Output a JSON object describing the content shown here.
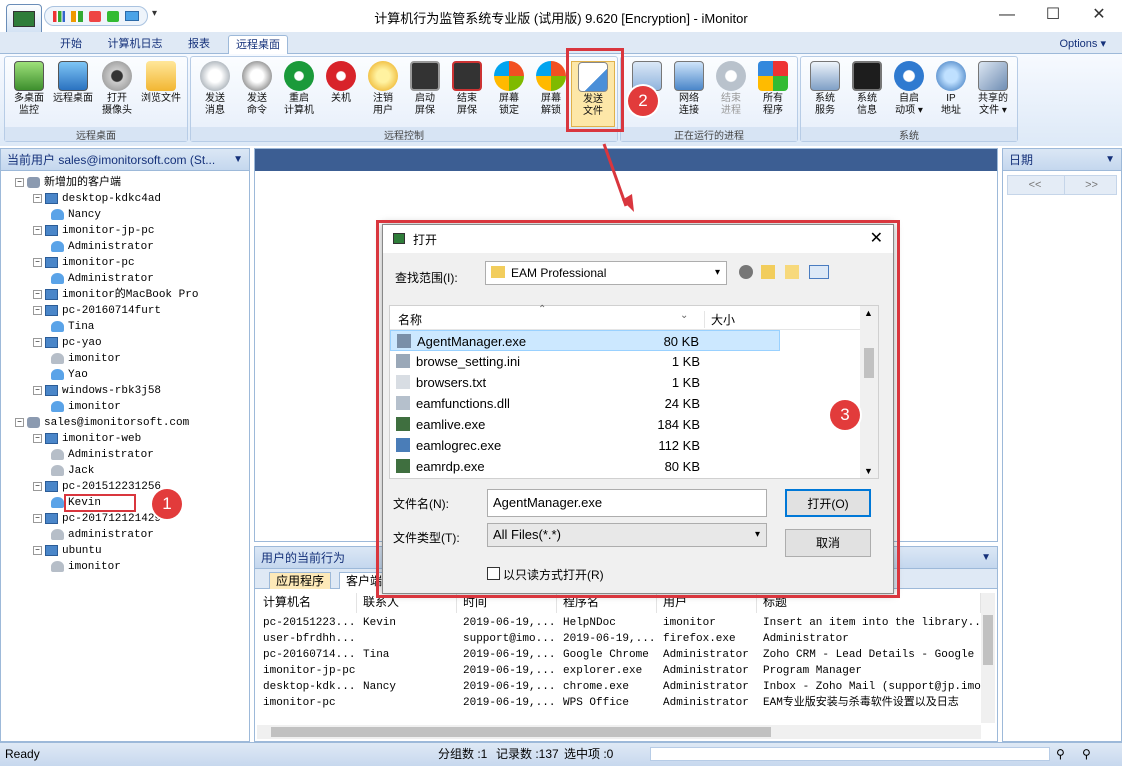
{
  "window": {
    "title": "计算机行为监管系统专业版 (试用版) 9.620 [Encryption] - iMonitor",
    "min": "—",
    "max": "☐",
    "close": "✕"
  },
  "tabs": [
    "开始",
    "计算机日志",
    "报表",
    "远程桌面"
  ],
  "options_label": "Options ▾",
  "ribbon": {
    "g1": {
      "label": "远程桌面",
      "buttons": [
        "多桌面\n监控",
        "远程桌面",
        "打开\n摄像头",
        "浏览文件"
      ]
    },
    "g2": {
      "label": "远程控制",
      "buttons": [
        "发送\n消息",
        "发送\n命令",
        "重启\n计算机",
        "关机",
        "注销\n用户",
        "启动\n屏保",
        "结束\n屏保",
        "屏幕\n锁定",
        "屏幕\n解锁",
        "发送\n文件"
      ]
    },
    "g3": {
      "label": "正在运行的进程",
      "buttons": [
        "进程",
        "网络\n连接",
        "结束\n进程",
        "所有\n程序"
      ]
    },
    "g4": {
      "label": "系统",
      "buttons": [
        "系统\n服务",
        "系统\n信息",
        "自启\n动项 ▾",
        "IP\n地址",
        "共享的\n文件 ▾"
      ]
    }
  },
  "left_pane": {
    "header": "当前用户 sales@imonitorsoft.com (St...",
    "tree": [
      {
        "t": "新增加的客户端",
        "lvl": 0,
        "k": "grp"
      },
      {
        "t": "desktop-kdkc4ad",
        "lvl": 1,
        "k": "comp"
      },
      {
        "t": "Nancy",
        "lvl": 2,
        "k": "user"
      },
      {
        "t": "imonitor-jp-pc",
        "lvl": 1,
        "k": "comp"
      },
      {
        "t": "Administrator",
        "lvl": 2,
        "k": "user"
      },
      {
        "t": "imonitor-pc",
        "lvl": 1,
        "k": "comp"
      },
      {
        "t": "Administrator",
        "lvl": 2,
        "k": "user"
      },
      {
        "t": "imonitor的MacBook Pro",
        "lvl": 1,
        "k": "comp"
      },
      {
        "t": "pc-20160714furt",
        "lvl": 1,
        "k": "comp"
      },
      {
        "t": "Tina",
        "lvl": 2,
        "k": "user"
      },
      {
        "t": "pc-yao",
        "lvl": 1,
        "k": "comp"
      },
      {
        "t": "imonitor",
        "lvl": 2,
        "k": "userg"
      },
      {
        "t": "Yao",
        "lvl": 2,
        "k": "user"
      },
      {
        "t": "windows-rbk3j58",
        "lvl": 1,
        "k": "comp"
      },
      {
        "t": "imonitor",
        "lvl": 2,
        "k": "user"
      },
      {
        "t": "sales@imonitorsoft.com",
        "lvl": 0,
        "k": "grp"
      },
      {
        "t": "imonitor-web",
        "lvl": 1,
        "k": "comp"
      },
      {
        "t": "Administrator",
        "lvl": 2,
        "k": "userg"
      },
      {
        "t": "Jack",
        "lvl": 2,
        "k": "userg"
      },
      {
        "t": "pc-201512231256",
        "lvl": 1,
        "k": "comp"
      },
      {
        "t": "Kevin",
        "lvl": 2,
        "k": "user"
      },
      {
        "t": "pc-201712121429",
        "lvl": 1,
        "k": "comp"
      },
      {
        "t": "administrator",
        "lvl": 2,
        "k": "userg"
      },
      {
        "t": "ubuntu",
        "lvl": 1,
        "k": "comp"
      },
      {
        "t": "imonitor",
        "lvl": 2,
        "k": "userg"
      }
    ]
  },
  "right_pane": {
    "header": "日期",
    "prev": "<<",
    "next": ">>"
  },
  "bottom_pane": {
    "header": "用户的当前行为",
    "tabs": [
      "应用程序",
      "客户端"
    ],
    "columns": [
      "计算机名",
      "联系人",
      "时间",
      "程序名",
      "用户",
      "标题"
    ],
    "rows": [
      [
        "pc-20151223...",
        "Kevin",
        "2019-06-19,...",
        "HelpNDoc",
        "imonitor",
        "Insert an item into the library..."
      ],
      [
        "user-bfrdhh...",
        "",
        "support@imo...",
        "2019-06-19,...",
        "firefox.exe",
        "Administrator"
      ],
      [
        "pc-20160714...",
        "Tina",
        "2019-06-19,...",
        "Google Chrome",
        "Administrator",
        "Zoho CRM - Lead Details - Google Chr"
      ],
      [
        "imonitor-jp-pc",
        "",
        "2019-06-19,...",
        "explorer.exe",
        "Administrator",
        "Program Manager"
      ],
      [
        "desktop-kdk...",
        "Nancy",
        "2019-06-19,...",
        "chrome.exe",
        "Administrator",
        "Inbox - Zoho Mail (support@jp.imonit"
      ],
      [
        "imonitor-pc",
        "",
        "2019-06-19,...",
        "WPS Office",
        "Administrator",
        "EAM专业版安装与杀毒软件设置以及日志"
      ]
    ]
  },
  "status": {
    "ready": "Ready",
    "groups": "分组数 :1",
    "records": "记录数 :137",
    "selected": "选中项 :0"
  },
  "dialog": {
    "title": "打开",
    "lookin_label": "查找范围(I):",
    "lookin_value": "EAM Professional",
    "col_name": "名称",
    "col_size": "大小",
    "files": [
      {
        "name": "AgentManager.exe",
        "size": "80 KB"
      },
      {
        "name": "browse_setting.ini",
        "size": "1 KB"
      },
      {
        "name": "browsers.txt",
        "size": "1 KB"
      },
      {
        "name": "eamfunctions.dll",
        "size": "24 KB"
      },
      {
        "name": "eamlive.exe",
        "size": "184 KB"
      },
      {
        "name": "eamlogrec.exe",
        "size": "112 KB"
      },
      {
        "name": "eamrdp.exe",
        "size": "80 KB"
      }
    ],
    "filename_label": "文件名(N):",
    "filename_value": "AgentManager.exe",
    "filetype_label": "文件类型(T):",
    "filetype_value": "All Files(*.*)",
    "readonly_label": "以只读方式打开(R)",
    "open_button": "打开(O)",
    "cancel_button": "取消"
  },
  "callouts": [
    "1",
    "2",
    "3"
  ],
  "colors": {
    "accent": "#3c5e93",
    "highlight": "#d9363e",
    "ribbon": "#dde9f7",
    "selection": "#cce8ff"
  }
}
